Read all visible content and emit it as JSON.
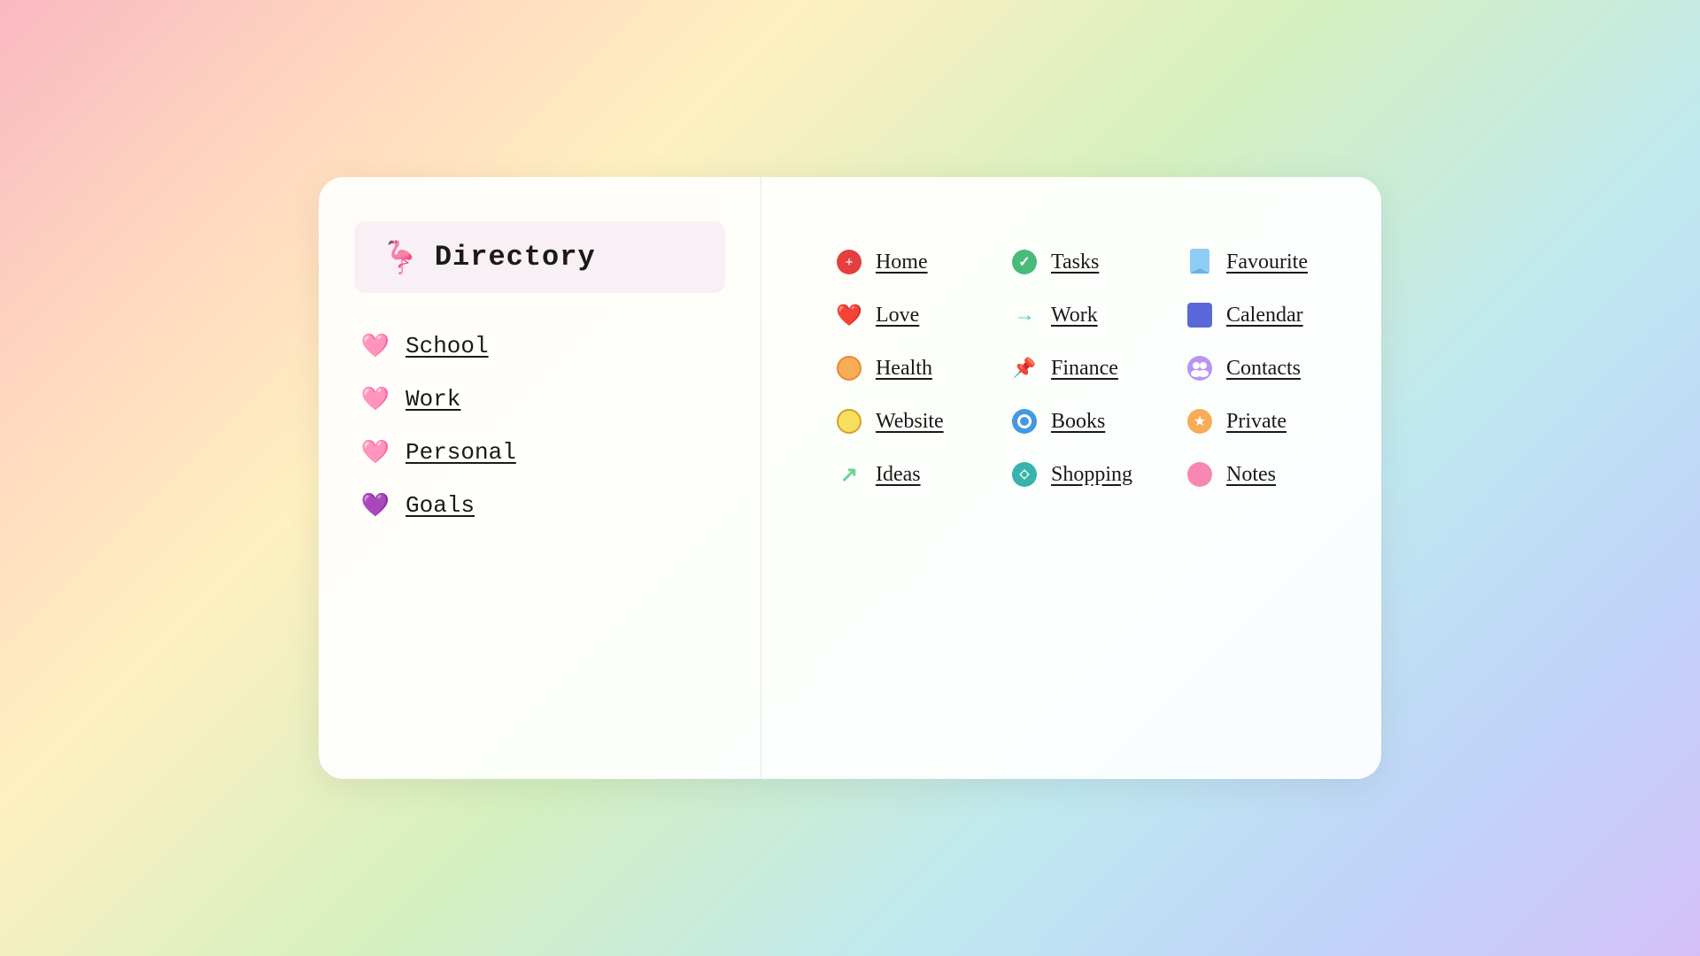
{
  "left": {
    "header": {
      "icon": "🦩",
      "title": "Directory"
    },
    "items": [
      {
        "id": "school",
        "emoji": "🩷",
        "label": "School"
      },
      {
        "id": "work",
        "emoji": "🩷",
        "label": "Work"
      },
      {
        "id": "personal",
        "emoji": "🩷",
        "label": "Personal"
      },
      {
        "id": "goals",
        "emoji": "💜",
        "label": "Goals"
      }
    ]
  },
  "right": {
    "columns": [
      [
        {
          "id": "home",
          "icon": "➕",
          "icon_type": "red-plus-circle",
          "label": "Home"
        },
        {
          "id": "love",
          "icon": "❤️",
          "icon_type": "red-heart",
          "label": "Love"
        },
        {
          "id": "health",
          "icon": "🟠",
          "icon_type": "orange-circle",
          "label": "Health"
        },
        {
          "id": "website",
          "icon": "🟡",
          "icon_type": "yellow-circle",
          "label": "Website"
        },
        {
          "id": "ideas",
          "icon": "↗",
          "icon_type": "green-arrow",
          "label": "Ideas"
        }
      ],
      [
        {
          "id": "tasks",
          "icon": "✅",
          "icon_type": "green-check",
          "label": "Tasks"
        },
        {
          "id": "work",
          "icon": "→",
          "icon_type": "teal-arrow",
          "label": "Work"
        },
        {
          "id": "finance",
          "icon": "📌",
          "icon_type": "red-pin",
          "label": "Finance"
        },
        {
          "id": "books",
          "icon": "📘",
          "icon_type": "blue-circle",
          "label": "Books"
        },
        {
          "id": "shopping",
          "icon": "🔄",
          "icon_type": "teal-circle",
          "label": "Shopping"
        }
      ],
      [
        {
          "id": "favourite",
          "icon": "🔖",
          "icon_type": "blue-bookmark",
          "label": "Favourite"
        },
        {
          "id": "calendar",
          "icon": "⬛",
          "icon_type": "purple-square",
          "label": "Calendar"
        },
        {
          "id": "contacts",
          "icon": "👥",
          "icon_type": "purple-people",
          "label": "Contacts"
        },
        {
          "id": "private",
          "icon": "⭐",
          "icon_type": "orange-star",
          "label": "Private"
        },
        {
          "id": "notes",
          "icon": "🟣",
          "icon_type": "pink-circle",
          "label": "Notes"
        }
      ]
    ]
  }
}
